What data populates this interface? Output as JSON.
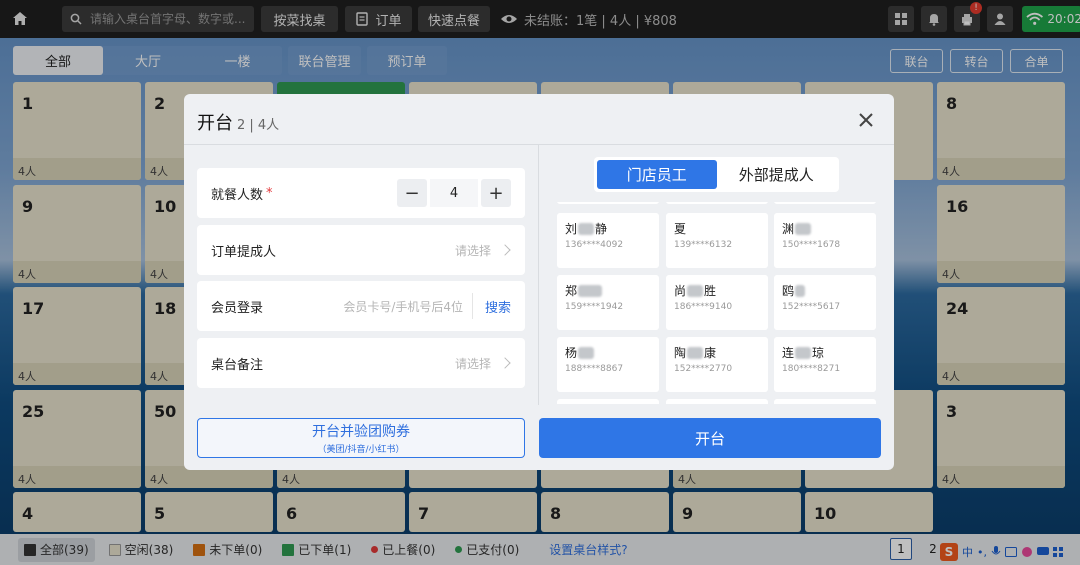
{
  "topbar": {
    "search_placeholder": "请输入桌台首字母、数字或...",
    "find_by_dish": "按菜找桌",
    "orders": "订单",
    "quick_order": "快速点餐",
    "unsettled_label": "未结账：",
    "unsettled_summary": "1笔 | 4人 | ¥808",
    "notification_badge": "!",
    "clock": "20:02"
  },
  "area_tabs": [
    "全部",
    "大厅",
    "一楼",
    "联台管理",
    "预订单"
  ],
  "table_actions": [
    "联台",
    "转台",
    "合单"
  ],
  "tables": [
    {
      "num": "1",
      "guests": "4人"
    },
    {
      "num": "2",
      "guests": "4人"
    },
    {
      "num": "8",
      "guests": "4人"
    },
    {
      "num": "9",
      "guests": "4人"
    },
    {
      "num": "10",
      "guests": "4人"
    },
    {
      "num": "16",
      "guests": "4人"
    },
    {
      "num": "17",
      "guests": "4人"
    },
    {
      "num": "18",
      "guests": "4人"
    },
    {
      "num": "24",
      "guests": "4人"
    },
    {
      "num": "25",
      "guests": "4人"
    },
    {
      "num": "50",
      "guests": "4人"
    },
    {
      "num": "3",
      "guests": "4人"
    },
    {
      "num": "",
      "guests": "4人"
    },
    {
      "num": "",
      "guests": "4人"
    },
    {
      "num": "4",
      "guests": ""
    },
    {
      "num": "5",
      "guests": ""
    },
    {
      "num": "6",
      "guests": ""
    },
    {
      "num": "7",
      "guests": ""
    },
    {
      "num": "8",
      "guests": ""
    },
    {
      "num": "9",
      "guests": ""
    },
    {
      "num": "10",
      "guests": ""
    }
  ],
  "legend": [
    {
      "label": "全部(39)",
      "color": "#333333",
      "shape": "square"
    },
    {
      "label": "空闲(38)",
      "color": "#e7e2cc",
      "shape": "square"
    },
    {
      "label": "未下单(0)",
      "color": "#d46f12",
      "shape": "square"
    },
    {
      "label": "已下单(1)",
      "color": "#2f9a52",
      "shape": "square"
    },
    {
      "label": "已上餐(0)",
      "color": "#e03a3a",
      "shape": "dot"
    },
    {
      "label": "已支付(0)",
      "color": "#2f9a52",
      "shape": "dot"
    }
  ],
  "style_link": "设置桌台样式?",
  "pagination": {
    "current": "1",
    "next": "2"
  },
  "ime": {
    "zh": "中"
  },
  "dialog": {
    "title": "开台",
    "subtitle": "2 | 4人",
    "guests_label": "就餐人数",
    "required_mark": "*",
    "guests_value": "4",
    "minus": "−",
    "plus": "+",
    "creator_label": "订单提成人",
    "creator_hint": "请选择",
    "member_label": "会员登录",
    "member_placeholder": "会员卡号/手机号后4位",
    "member_search": "搜索",
    "note_label": "桌台备注",
    "note_hint": "请选择",
    "seg_staff": "门店员工",
    "seg_external": "外部提成人",
    "staff": [
      {
        "name_a": "刘",
        "name_b": "静",
        "phone": "136****4092"
      },
      {
        "name_a": "夏",
        "name_b": "",
        "phone": "139****6132"
      },
      {
        "name_a": "渊",
        "name_b": "",
        "phone": "150****1678"
      },
      {
        "name_a": "郑",
        "name_b": "",
        "phone": "159****1942"
      },
      {
        "name_a": "尚",
        "name_b": "胜",
        "phone": "186****9140"
      },
      {
        "name_a": "鸥",
        "name_b": "",
        "phone": "152****5617"
      },
      {
        "name_a": "杨",
        "name_b": "",
        "phone": "188****8867"
      },
      {
        "name_a": "陶",
        "name_b": "康",
        "phone": "152****2770"
      },
      {
        "name_a": "连",
        "name_b": "琼",
        "phone": "180****8271"
      }
    ],
    "btn_coupon": "开台并验团购券",
    "btn_coupon_sub": "（美团/抖音/小红书）",
    "btn_open": "开台"
  }
}
